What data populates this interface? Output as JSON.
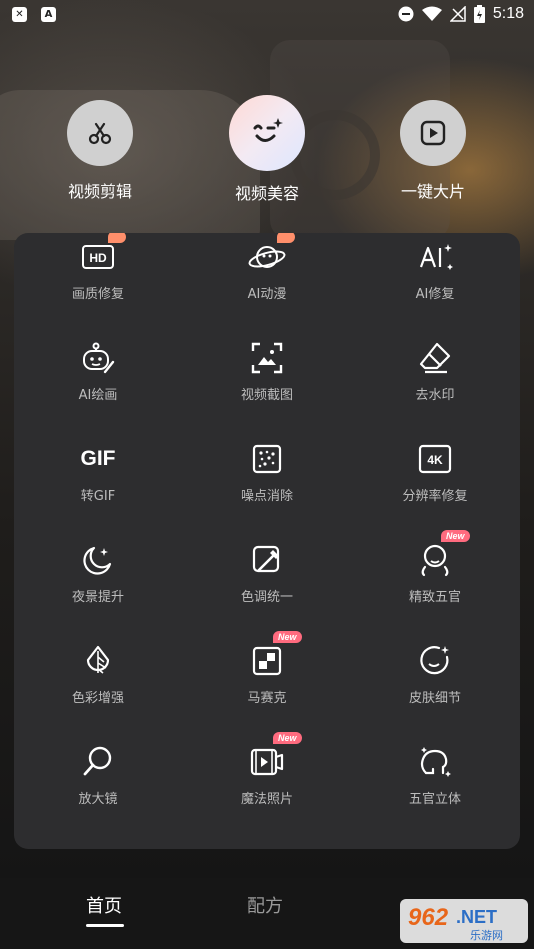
{
  "status_bar": {
    "time": "5:18"
  },
  "top_tools": [
    {
      "label": "视频剪辑",
      "icon": "scissors-icon"
    },
    {
      "label": "视频美容",
      "icon": "wink-face-icon"
    },
    {
      "label": "一键大片",
      "icon": "play-icon"
    }
  ],
  "features": [
    {
      "label": "画质修复",
      "icon": "hd-icon",
      "badge": ""
    },
    {
      "label": "AI动漫",
      "icon": "anime-planet-icon",
      "badge": ""
    },
    {
      "label": "AI修复",
      "icon": "ai-sparkle-icon",
      "badge": ""
    },
    {
      "label": "AI绘画",
      "icon": "robot-paint-icon",
      "badge": ""
    },
    {
      "label": "视频截图",
      "icon": "screenshot-icon",
      "badge": ""
    },
    {
      "label": "去水印",
      "icon": "eraser-icon",
      "badge": ""
    },
    {
      "label": "转GIF",
      "icon": "gif-icon",
      "badge": ""
    },
    {
      "label": "噪点消除",
      "icon": "noise-icon",
      "badge": ""
    },
    {
      "label": "分辨率修复",
      "icon": "4k-icon",
      "badge": ""
    },
    {
      "label": "夜景提升",
      "icon": "moon-icon",
      "badge": ""
    },
    {
      "label": "色调统一",
      "icon": "color-picker-icon",
      "badge": ""
    },
    {
      "label": "精致五官",
      "icon": "face-icon",
      "badge": "New"
    },
    {
      "label": "色彩增强",
      "icon": "color-drop-icon",
      "badge": ""
    },
    {
      "label": "马赛克",
      "icon": "mosaic-icon",
      "badge": "New"
    },
    {
      "label": "皮肤细节",
      "icon": "skin-icon",
      "badge": ""
    },
    {
      "label": "放大镜",
      "icon": "magnifier-icon",
      "badge": ""
    },
    {
      "label": "魔法照片",
      "icon": "magic-photo-icon",
      "badge": "New"
    },
    {
      "label": "五官立体",
      "icon": "face-3d-icon",
      "badge": ""
    }
  ],
  "gif_text": "GIF",
  "hd_text": "HD",
  "tabs": [
    {
      "label": "首页"
    },
    {
      "label": "配方"
    }
  ],
  "watermark": {
    "text": "962",
    "suffix": ".NET",
    "sub": "乐游网"
  }
}
